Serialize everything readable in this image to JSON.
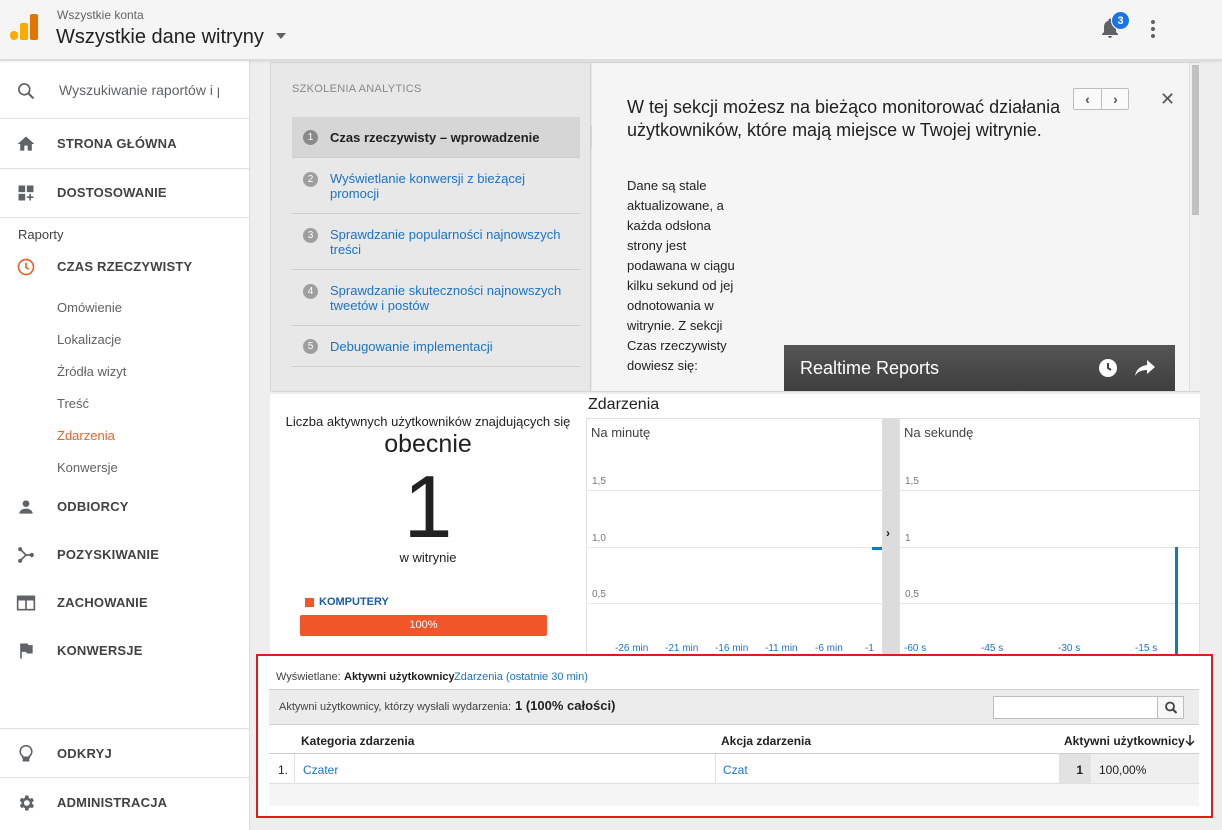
{
  "header": {
    "account_small": "Wszystkie konta",
    "account_big": "Wszystkie dane witryny",
    "notification_count": "3"
  },
  "sidebar": {
    "search_placeholder": "Wyszukiwanie raportów i pomocy",
    "home": "STRONA GŁÓWNA",
    "customize": "DOSTOSOWANIE",
    "reports_label": "Raporty",
    "realtime": "CZAS RZECZYWISTY",
    "realtime_sub": [
      "Omówienie",
      "Lokalizacje",
      "Źródła wizyt",
      "Treść",
      "Zdarzenia",
      "Konwersje"
    ],
    "audience": "ODBIORCY",
    "acquisition": "POZYSKIWANIE",
    "behavior": "ZACHOWANIE",
    "conversions": "KONWERSJE",
    "discover": "ODKRYJ",
    "admin": "ADMINISTRACJA",
    "accent_color": "#e8632b"
  },
  "training": {
    "title": "SZKOLENIA ANALYTICS",
    "steps": [
      {
        "num": "1",
        "label": "Czas rzeczywisty – wprowadzenie"
      },
      {
        "num": "2",
        "label": "Wyświetlanie konwersji z bieżącej promocji"
      },
      {
        "num": "3",
        "label": "Sprawdzanie popularności najnowszych treści"
      },
      {
        "num": "4",
        "label": "Sprawdzanie skuteczności najnowszych tweetów i postów"
      },
      {
        "num": "5",
        "label": "Debugowanie implementacji"
      }
    ],
    "heading": "W tej sekcji możesz na bieżąco monitorować działania użytkowników, które mają miejsce w Twojej witrynie.",
    "body": "Dane są stale aktualizowane, a każda odsłona strony jest podawana w ciągu kilku sekund od jej odnotowania w witrynie. Z sekcji Czas rzeczywisty dowiesz się:",
    "video_title": "Realtime Reports",
    "prev": "‹",
    "next": "›",
    "close": "✕"
  },
  "active_users": {
    "title": "Liczba aktywnych użytkowników znajdujących się",
    "now": "obecnie",
    "count": "1",
    "on_site": "w witrynie",
    "device_label": "KOMPUTERY",
    "device_pct": "100%",
    "device_fraction": 1.0
  },
  "events": {
    "title": "Zdarzenia",
    "per_minute_label": "Na minutę",
    "per_second_label": "Na sekundę"
  },
  "chart_data": [
    {
      "type": "bar",
      "title": "Na minutę",
      "y_ticks": [
        "1,5",
        "1,0",
        "0,5"
      ],
      "ylim": [
        0,
        1.5
      ],
      "x_ticks": [
        "-26 min",
        "-21 min",
        "-16 min",
        "-11 min",
        "-6 min",
        "-1"
      ],
      "values": [
        {
          "x": "-1 min",
          "y": 1
        }
      ]
    },
    {
      "type": "bar",
      "title": "Na sekundę",
      "y_ticks": [
        "1,5",
        "1",
        "0,5"
      ],
      "ylim": [
        0,
        1.5
      ],
      "x_ticks": [
        "-60 s",
        "-45 s",
        "-30 s",
        "-15 s"
      ],
      "values": [
        {
          "x": "0 s",
          "y": 1
        }
      ]
    }
  ],
  "table": {
    "shown_label": "Wyświetlane:",
    "shown_active": "Aktywni użytkownicy",
    "shown_link": "Zdarzenia (ostatnie 30 min)",
    "summary_label": "Aktywni użytkownicy, którzy wysłali wydarzenia:",
    "summary_value": "1 (100% całości)",
    "columns": [
      "Kategoria zdarzenia",
      "Akcja zdarzenia",
      "Aktywni użytkownicy"
    ],
    "rows": [
      {
        "index": "1.",
        "category": "Czater",
        "action": "Czat",
        "users": "1",
        "pct": "100,00%"
      }
    ]
  }
}
